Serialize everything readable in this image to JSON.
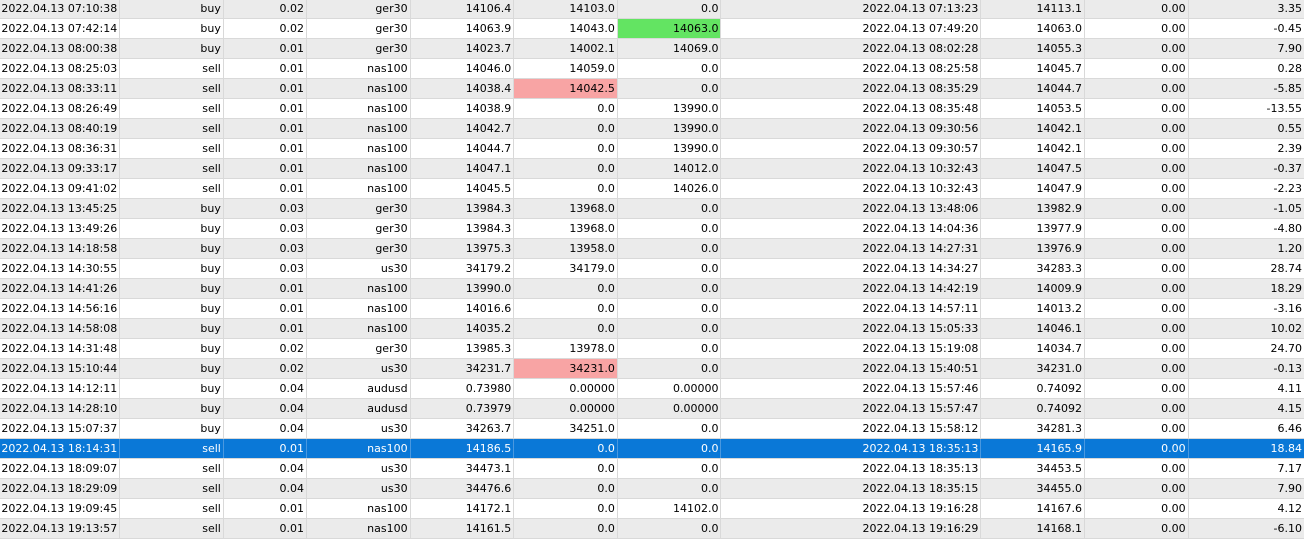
{
  "colors": {
    "row_alt": "#ebebeb",
    "selected_row": "#0a78d7",
    "highlight_red": "#f8a4a4",
    "highlight_green": "#63e462"
  },
  "selected_row_index": 22,
  "rows": [
    {
      "open_time": "2022.04.13 07:10:38",
      "type": "buy",
      "volume": "0.02",
      "symbol": "ger30",
      "price": "14106.4",
      "sl": "14103.0",
      "tp": "0.0",
      "close_time": "2022.04.13 07:13:23",
      "close_price": "14113.1",
      "swap": "0.00",
      "profit": "3.35"
    },
    {
      "open_time": "2022.04.13 07:42:14",
      "type": "buy",
      "volume": "0.02",
      "symbol": "ger30",
      "price": "14063.9",
      "sl": "14043.0",
      "tp": "14063.0",
      "close_time": "2022.04.13 07:49:20",
      "close_price": "14063.0",
      "swap": "0.00",
      "profit": "-0.45",
      "tp_highlight": "green"
    },
    {
      "open_time": "2022.04.13 08:00:38",
      "type": "buy",
      "volume": "0.01",
      "symbol": "ger30",
      "price": "14023.7",
      "sl": "14002.1",
      "tp": "14069.0",
      "close_time": "2022.04.13 08:02:28",
      "close_price": "14055.3",
      "swap": "0.00",
      "profit": "7.90"
    },
    {
      "open_time": "2022.04.13 08:25:03",
      "type": "sell",
      "volume": "0.01",
      "symbol": "nas100",
      "price": "14046.0",
      "sl": "14059.0",
      "tp": "0.0",
      "close_time": "2022.04.13 08:25:58",
      "close_price": "14045.7",
      "swap": "0.00",
      "profit": "0.28"
    },
    {
      "open_time": "2022.04.13 08:33:11",
      "type": "sell",
      "volume": "0.01",
      "symbol": "nas100",
      "price": "14038.4",
      "sl": "14042.5",
      "tp": "0.0",
      "close_time": "2022.04.13 08:35:29",
      "close_price": "14044.7",
      "swap": "0.00",
      "profit": "-5.85",
      "sl_highlight": "red"
    },
    {
      "open_time": "2022.04.13 08:26:49",
      "type": "sell",
      "volume": "0.01",
      "symbol": "nas100",
      "price": "14038.9",
      "sl": "0.0",
      "tp": "13990.0",
      "close_time": "2022.04.13 08:35:48",
      "close_price": "14053.5",
      "swap": "0.00",
      "profit": "-13.55"
    },
    {
      "open_time": "2022.04.13 08:40:19",
      "type": "sell",
      "volume": "0.01",
      "symbol": "nas100",
      "price": "14042.7",
      "sl": "0.0",
      "tp": "13990.0",
      "close_time": "2022.04.13 09:30:56",
      "close_price": "14042.1",
      "swap": "0.00",
      "profit": "0.55"
    },
    {
      "open_time": "2022.04.13 08:36:31",
      "type": "sell",
      "volume": "0.01",
      "symbol": "nas100",
      "price": "14044.7",
      "sl": "0.0",
      "tp": "13990.0",
      "close_time": "2022.04.13 09:30:57",
      "close_price": "14042.1",
      "swap": "0.00",
      "profit": "2.39"
    },
    {
      "open_time": "2022.04.13 09:33:17",
      "type": "sell",
      "volume": "0.01",
      "symbol": "nas100",
      "price": "14047.1",
      "sl": "0.0",
      "tp": "14012.0",
      "close_time": "2022.04.13 10:32:43",
      "close_price": "14047.5",
      "swap": "0.00",
      "profit": "-0.37"
    },
    {
      "open_time": "2022.04.13 09:41:02",
      "type": "sell",
      "volume": "0.01",
      "symbol": "nas100",
      "price": "14045.5",
      "sl": "0.0",
      "tp": "14026.0",
      "close_time": "2022.04.13 10:32:43",
      "close_price": "14047.9",
      "swap": "0.00",
      "profit": "-2.23"
    },
    {
      "open_time": "2022.04.13 13:45:25",
      "type": "buy",
      "volume": "0.03",
      "symbol": "ger30",
      "price": "13984.3",
      "sl": "13968.0",
      "tp": "0.0",
      "close_time": "2022.04.13 13:48:06",
      "close_price": "13982.9",
      "swap": "0.00",
      "profit": "-1.05"
    },
    {
      "open_time": "2022.04.13 13:49:26",
      "type": "buy",
      "volume": "0.03",
      "symbol": "ger30",
      "price": "13984.3",
      "sl": "13968.0",
      "tp": "0.0",
      "close_time": "2022.04.13 14:04:36",
      "close_price": "13977.9",
      "swap": "0.00",
      "profit": "-4.80"
    },
    {
      "open_time": "2022.04.13 14:18:58",
      "type": "buy",
      "volume": "0.03",
      "symbol": "ger30",
      "price": "13975.3",
      "sl": "13958.0",
      "tp": "0.0",
      "close_time": "2022.04.13 14:27:31",
      "close_price": "13976.9",
      "swap": "0.00",
      "profit": "1.20"
    },
    {
      "open_time": "2022.04.13 14:30:55",
      "type": "buy",
      "volume": "0.03",
      "symbol": "us30",
      "price": "34179.2",
      "sl": "34179.0",
      "tp": "0.0",
      "close_time": "2022.04.13 14:34:27",
      "close_price": "34283.3",
      "swap": "0.00",
      "profit": "28.74"
    },
    {
      "open_time": "2022.04.13 14:41:26",
      "type": "buy",
      "volume": "0.01",
      "symbol": "nas100",
      "price": "13990.0",
      "sl": "0.0",
      "tp": "0.0",
      "close_time": "2022.04.13 14:42:19",
      "close_price": "14009.9",
      "swap": "0.00",
      "profit": "18.29"
    },
    {
      "open_time": "2022.04.13 14:56:16",
      "type": "buy",
      "volume": "0.01",
      "symbol": "nas100",
      "price": "14016.6",
      "sl": "0.0",
      "tp": "0.0",
      "close_time": "2022.04.13 14:57:11",
      "close_price": "14013.2",
      "swap": "0.00",
      "profit": "-3.16"
    },
    {
      "open_time": "2022.04.13 14:58:08",
      "type": "buy",
      "volume": "0.01",
      "symbol": "nas100",
      "price": "14035.2",
      "sl": "0.0",
      "tp": "0.0",
      "close_time": "2022.04.13 15:05:33",
      "close_price": "14046.1",
      "swap": "0.00",
      "profit": "10.02"
    },
    {
      "open_time": "2022.04.13 14:31:48",
      "type": "buy",
      "volume": "0.02",
      "symbol": "ger30",
      "price": "13985.3",
      "sl": "13978.0",
      "tp": "0.0",
      "close_time": "2022.04.13 15:19:08",
      "close_price": "14034.7",
      "swap": "0.00",
      "profit": "24.70"
    },
    {
      "open_time": "2022.04.13 15:10:44",
      "type": "buy",
      "volume": "0.02",
      "symbol": "us30",
      "price": "34231.7",
      "sl": "34231.0",
      "tp": "0.0",
      "close_time": "2022.04.13 15:40:51",
      "close_price": "34231.0",
      "swap": "0.00",
      "profit": "-0.13",
      "sl_highlight": "red"
    },
    {
      "open_time": "2022.04.13 14:12:11",
      "type": "buy",
      "volume": "0.04",
      "symbol": "audusd",
      "price": "0.73980",
      "sl": "0.00000",
      "tp": "0.00000",
      "close_time": "2022.04.13 15:57:46",
      "close_price": "0.74092",
      "swap": "0.00",
      "profit": "4.11"
    },
    {
      "open_time": "2022.04.13 14:28:10",
      "type": "buy",
      "volume": "0.04",
      "symbol": "audusd",
      "price": "0.73979",
      "sl": "0.00000",
      "tp": "0.00000",
      "close_time": "2022.04.13 15:57:47",
      "close_price": "0.74092",
      "swap": "0.00",
      "profit": "4.15"
    },
    {
      "open_time": "2022.04.13 15:07:37",
      "type": "buy",
      "volume": "0.04",
      "symbol": "us30",
      "price": "34263.7",
      "sl": "34251.0",
      "tp": "0.0",
      "close_time": "2022.04.13 15:58:12",
      "close_price": "34281.3",
      "swap": "0.00",
      "profit": "6.46"
    },
    {
      "open_time": "2022.04.13 18:14:31",
      "type": "sell",
      "volume": "0.01",
      "symbol": "nas100",
      "price": "14186.5",
      "sl": "0.0",
      "tp": "0.0",
      "close_time": "2022.04.13 18:35:13",
      "close_price": "14165.9",
      "swap": "0.00",
      "profit": "18.84"
    },
    {
      "open_time": "2022.04.13 18:09:07",
      "type": "sell",
      "volume": "0.04",
      "symbol": "us30",
      "price": "34473.1",
      "sl": "0.0",
      "tp": "0.0",
      "close_time": "2022.04.13 18:35:13",
      "close_price": "34453.5",
      "swap": "0.00",
      "profit": "7.17"
    },
    {
      "open_time": "2022.04.13 18:29:09",
      "type": "sell",
      "volume": "0.04",
      "symbol": "us30",
      "price": "34476.6",
      "sl": "0.0",
      "tp": "0.0",
      "close_time": "2022.04.13 18:35:15",
      "close_price": "34455.0",
      "swap": "0.00",
      "profit": "7.90"
    },
    {
      "open_time": "2022.04.13 19:09:45",
      "type": "sell",
      "volume": "0.01",
      "symbol": "nas100",
      "price": "14172.1",
      "sl": "0.0",
      "tp": "14102.0",
      "close_time": "2022.04.13 19:16:28",
      "close_price": "14167.6",
      "swap": "0.00",
      "profit": "4.12"
    },
    {
      "open_time": "2022.04.13 19:13:57",
      "type": "sell",
      "volume": "0.01",
      "symbol": "nas100",
      "price": "14161.5",
      "sl": "0.0",
      "tp": "0.0",
      "close_time": "2022.04.13 19:16:29",
      "close_price": "14168.1",
      "swap": "0.00",
      "profit": "-6.10"
    }
  ]
}
